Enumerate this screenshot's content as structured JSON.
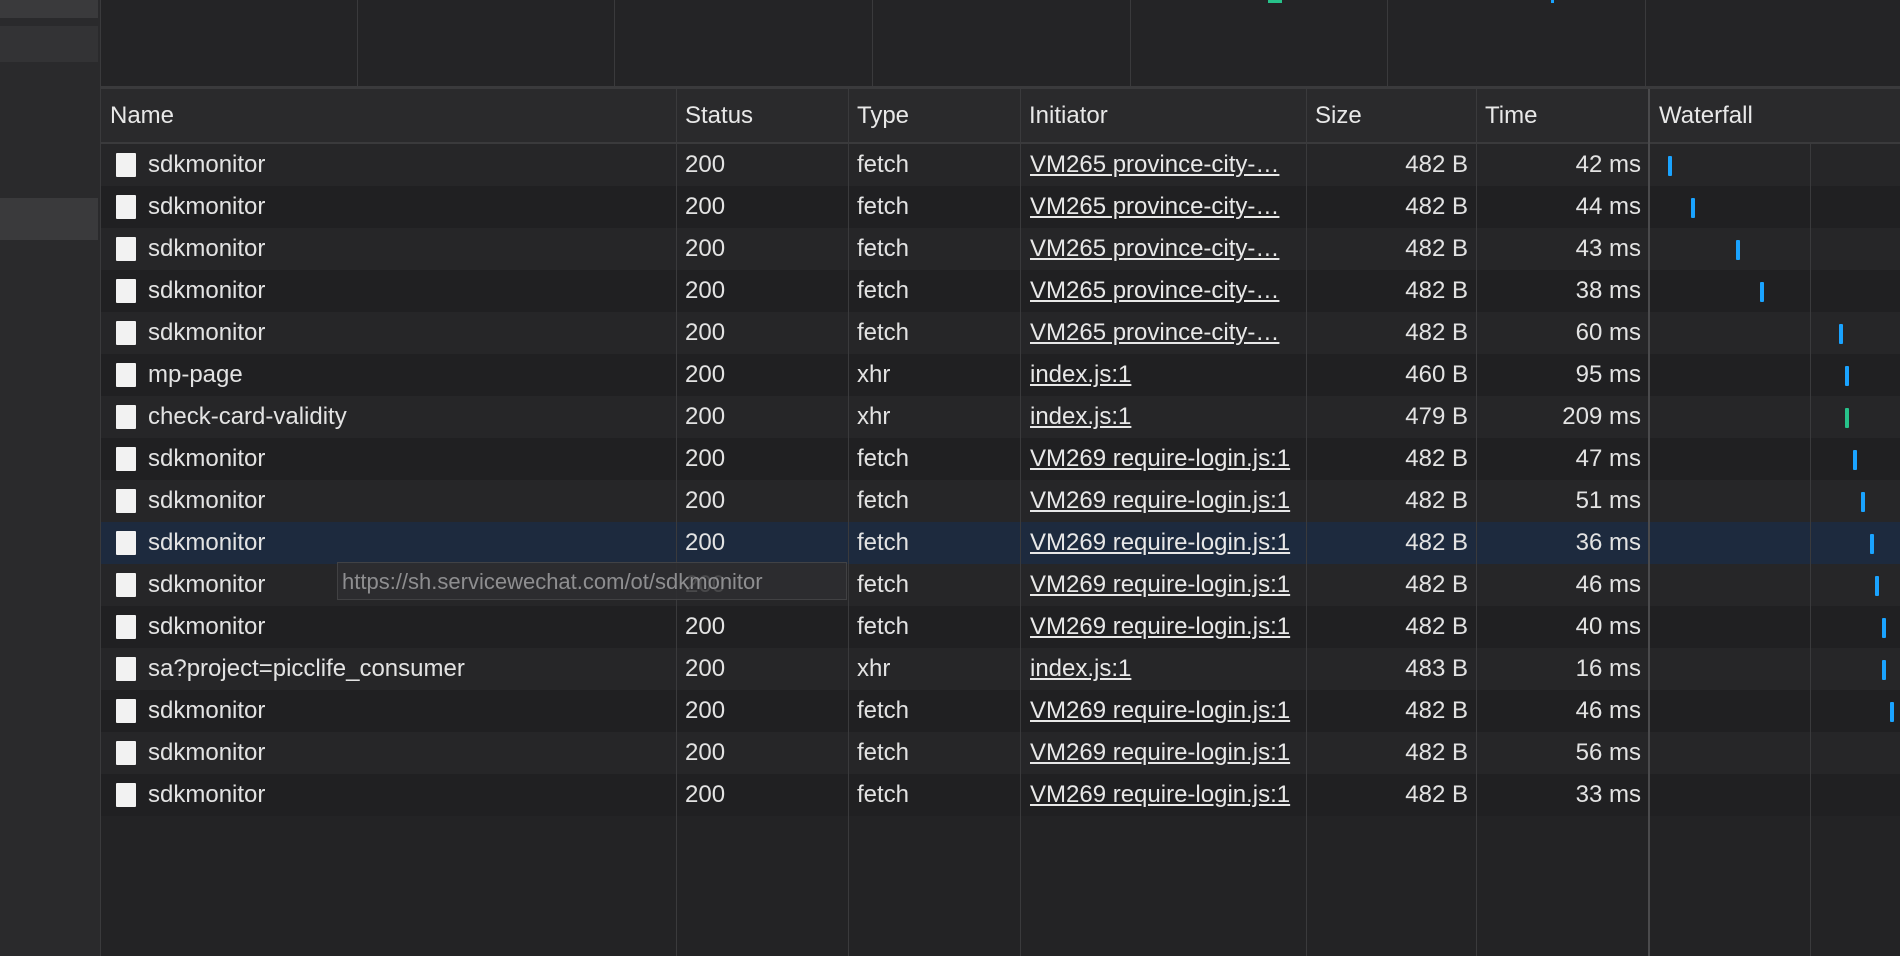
{
  "columns": {
    "name": "Name",
    "status": "Status",
    "type": "Type",
    "initiator": "Initiator",
    "size": "Size",
    "time": "Time",
    "waterfall": "Waterfall"
  },
  "requests": [
    {
      "name": "sdkmonitor",
      "status": "200",
      "type": "fetch",
      "initiator": "VM265 province-city-…",
      "size": "482 B",
      "time": "42 ms"
    },
    {
      "name": "sdkmonitor",
      "status": "200",
      "type": "fetch",
      "initiator": "VM265 province-city-…",
      "size": "482 B",
      "time": "44 ms"
    },
    {
      "name": "sdkmonitor",
      "status": "200",
      "type": "fetch",
      "initiator": "VM265 province-city-…",
      "size": "482 B",
      "time": "43 ms"
    },
    {
      "name": "sdkmonitor",
      "status": "200",
      "type": "fetch",
      "initiator": "VM265 province-city-…",
      "size": "482 B",
      "time": "38 ms"
    },
    {
      "name": "sdkmonitor",
      "status": "200",
      "type": "fetch",
      "initiator": "VM265 province-city-…",
      "size": "482 B",
      "time": "60 ms"
    },
    {
      "name": "mp-page",
      "status": "200",
      "type": "xhr",
      "initiator": "index.js:1",
      "size": "460 B",
      "time": "95 ms"
    },
    {
      "name": "check-card-validity",
      "status": "200",
      "type": "xhr",
      "initiator": "index.js:1",
      "size": "479 B",
      "time": "209 ms"
    },
    {
      "name": "sdkmonitor",
      "status": "200",
      "type": "fetch",
      "initiator": "VM269 require-login.js:1",
      "size": "482 B",
      "time": "47 ms"
    },
    {
      "name": "sdkmonitor",
      "status": "200",
      "type": "fetch",
      "initiator": "VM269 require-login.js:1",
      "size": "482 B",
      "time": "51 ms"
    },
    {
      "name": "sdkmonitor",
      "status": "200",
      "type": "fetch",
      "initiator": "VM269 require-login.js:1",
      "size": "482 B",
      "time": "36 ms"
    },
    {
      "name": "sdkmonitor",
      "status": "200",
      "type": "fetch",
      "initiator": "VM269 require-login.js:1",
      "size": "482 B",
      "time": "46 ms"
    },
    {
      "name": "sdkmonitor",
      "status": "200",
      "type": "fetch",
      "initiator": "VM269 require-login.js:1",
      "size": "482 B",
      "time": "40 ms"
    },
    {
      "name": "sa?project=picclife_consumer",
      "status": "200",
      "type": "xhr",
      "initiator": "index.js:1",
      "size": "483 B",
      "time": "16 ms"
    },
    {
      "name": "sdkmonitor",
      "status": "200",
      "type": "fetch",
      "initiator": "VM269 require-login.js:1",
      "size": "482 B",
      "time": "46 ms"
    },
    {
      "name": "sdkmonitor",
      "status": "200",
      "type": "fetch",
      "initiator": "VM269 require-login.js:1",
      "size": "482 B",
      "time": "56 ms"
    },
    {
      "name": "sdkmonitor",
      "status": "200",
      "type": "fetch",
      "initiator": "VM269 require-login.js:1",
      "size": "482 B",
      "time": "33 ms"
    }
  ],
  "selected_row": 9,
  "tooltip": "https://sh.servicewechat.com/ot/sdkmonitor",
  "colors": {
    "waterfall_bar": "#1aa3ff",
    "waterfall_bar_alt": "#27c28a",
    "selected_row": "#1d2a3e"
  }
}
